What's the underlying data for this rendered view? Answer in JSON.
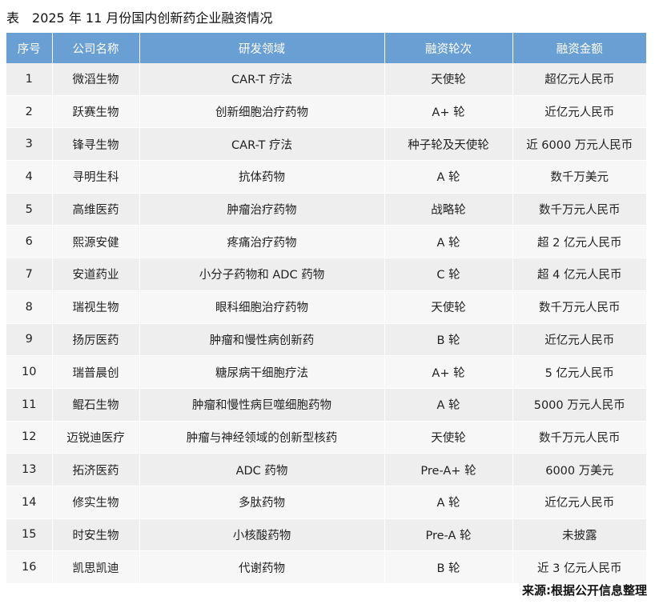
{
  "caption": {
    "prefix": "表",
    "title": "2025 年 11 月份国内创新药企业融资情况"
  },
  "table": {
    "headers": [
      "序号",
      "公司名称",
      "研发领域",
      "融资轮次",
      "融资金额"
    ],
    "rows": [
      [
        "1",
        "微滔生物",
        "CAR-T 疗法",
        "天使轮",
        "超亿元人民币"
      ],
      [
        "2",
        "跃赛生物",
        "创新细胞治疗药物",
        "A+ 轮",
        "近亿元人民币"
      ],
      [
        "3",
        "锋寻生物",
        "CAR-T 疗法",
        "种子轮及天使轮",
        "近 6000 万元人民币"
      ],
      [
        "4",
        "寻明生科",
        "抗体药物",
        "A 轮",
        "数千万美元"
      ],
      [
        "5",
        "高维医药",
        "肿瘤治疗药物",
        "战略轮",
        "数千万元人民币"
      ],
      [
        "6",
        "熙源安健",
        "疼痛治疗药物",
        "A 轮",
        "超 2 亿元人民币"
      ],
      [
        "7",
        "安道药业",
        "小分子药物和 ADC 药物",
        "C 轮",
        "超 4 亿元人民币"
      ],
      [
        "8",
        "瑞视生物",
        "眼科细胞治疗药物",
        "天使轮",
        "数千万元人民币"
      ],
      [
        "9",
        "扬厉医药",
        "肿瘤和慢性病创新药",
        "B 轮",
        "近亿元人民币"
      ],
      [
        "10",
        "瑞普晨创",
        "糖尿病干细胞疗法",
        "A+ 轮",
        "5 亿元人民币"
      ],
      [
        "11",
        "鲲石生物",
        "肿瘤和慢性病巨噬细胞药物",
        "A 轮",
        "5000 万元人民币"
      ],
      [
        "12",
        "迈锐迪医疗",
        "肿瘤与神经领域的创新型核药",
        "天使轮",
        "数千万元人民币"
      ],
      [
        "13",
        "拓济医药",
        "ADC 药物",
        "Pre-A+ 轮",
        "6000 万美元"
      ],
      [
        "14",
        "修实生物",
        "多肽药物",
        "A 轮",
        "近亿元人民币"
      ],
      [
        "15",
        "时安生物",
        "小核酸药物",
        "Pre-A 轮",
        "未披露"
      ],
      [
        "16",
        "凯思凯迪",
        "代谢药物",
        "B 轮",
        "近 3 亿元人民币"
      ]
    ]
  },
  "source": "来源:根据公开信息整理"
}
